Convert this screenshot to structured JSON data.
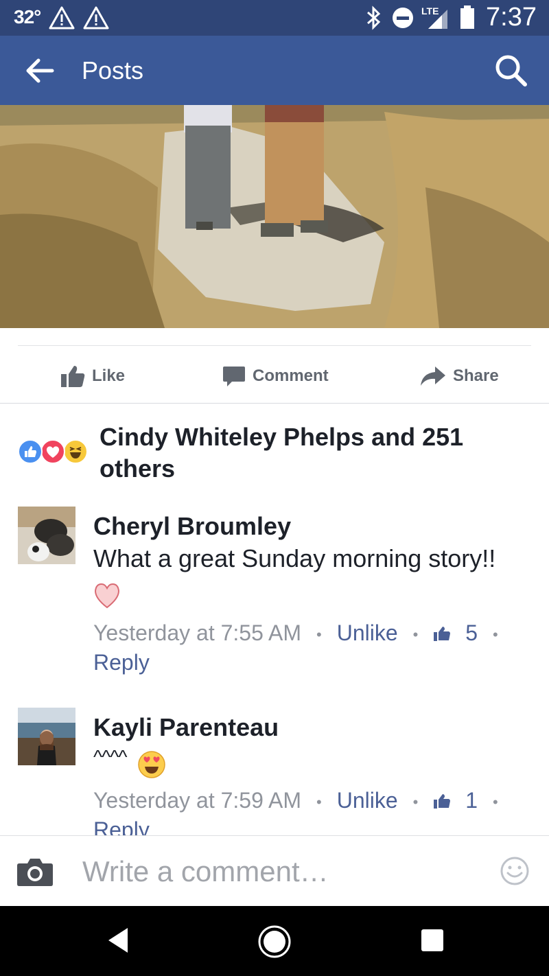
{
  "status_bar": {
    "temperature": "32°",
    "network": "LTE",
    "time": "7:37",
    "icons": [
      "warning-icon",
      "warning-icon",
      "bluetooth-icon",
      "do-not-disturb-icon",
      "signal-icon",
      "battery-icon"
    ]
  },
  "app_bar": {
    "title": "Posts",
    "back_icon": "arrow-left-icon",
    "search_icon": "search-icon"
  },
  "post_actions": [
    {
      "label": "Like",
      "icon": "thumbs-up-icon"
    },
    {
      "label": "Comment",
      "icon": "comment-icon"
    },
    {
      "label": "Share",
      "icon": "share-icon"
    }
  ],
  "reactions": {
    "icons": [
      "like-reaction-icon",
      "love-reaction-icon",
      "haha-reaction-icon"
    ],
    "summary": "Cindy Whiteley Phelps and 251 others"
  },
  "comments": [
    {
      "author": "Cheryl Broumley",
      "text": "What a great Sunday morning story!!",
      "timestamp": "Yesterday at 7:55 AM",
      "unlike_label": "Unlike",
      "like_count": "5",
      "reply_label": "Reply"
    },
    {
      "author": "Kayli Parenteau",
      "text": "^^^^",
      "timestamp": "Yesterday at 7:59 AM",
      "unlike_label": "Unlike",
      "like_count": "1",
      "reply_label": "Reply"
    }
  ],
  "composer": {
    "placeholder": "Write a comment…"
  },
  "colors": {
    "status_bar": "#2f4577",
    "app_bar": "#3b5998",
    "link": "#4b6096",
    "meta_gray": "#90949c"
  }
}
